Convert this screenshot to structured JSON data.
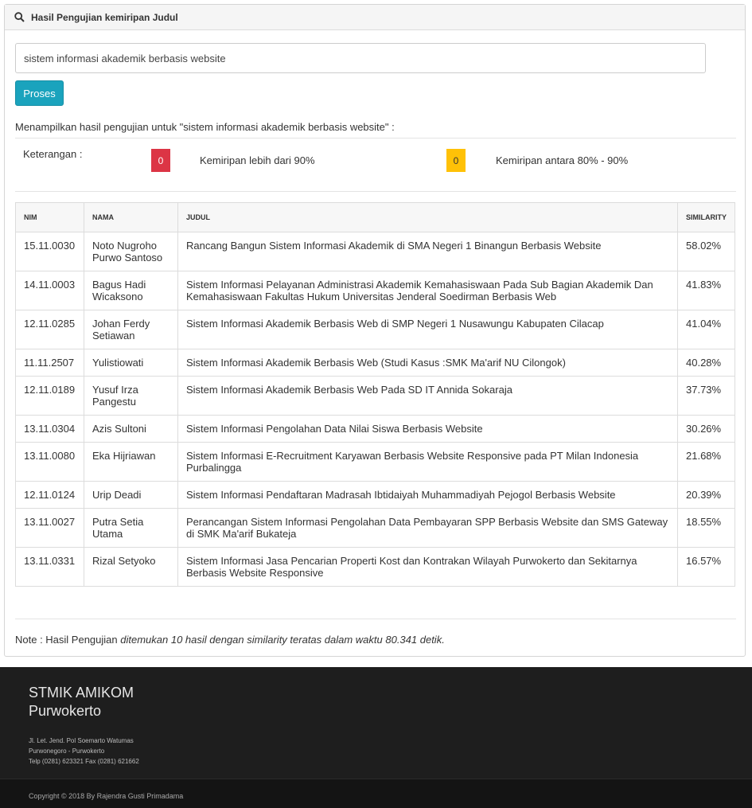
{
  "panel": {
    "title": "Hasil Pengujian kemiripan Judul"
  },
  "search": {
    "value": "sistem informasi akademik berbasis website"
  },
  "button": {
    "label": "Proses"
  },
  "result_message": "Menampilkan hasil pengujian untuk \"sistem informasi akademik berbasis website\" :",
  "legend": {
    "label": "Keterangan :",
    "red_count": "0",
    "red_text": "Kemiripan lebih dari 90%",
    "yellow_count": "0",
    "yellow_text": "Kemiripan antara 80% - 90%",
    "colors": {
      "red": "#dc3545",
      "yellow": "#ffc107"
    }
  },
  "table": {
    "headers": [
      "NIM",
      "NAMA",
      "JUDUL",
      "SIMILARITY"
    ],
    "rows": [
      [
        "15.11.0030",
        "Noto Nugroho Purwo Santoso",
        "Rancang Bangun Sistem Informasi Akademik di SMA Negeri 1 Binangun Berbasis Website",
        "58.02%"
      ],
      [
        "14.11.0003",
        "Bagus Hadi Wicaksono",
        "Sistem Informasi Pelayanan Administrasi Akademik Kemahasiswaan Pada Sub Bagian Akademik Dan Kemahasiswaan Fakultas Hukum Universitas Jenderal Soedirman Berbasis Web",
        "41.83%"
      ],
      [
        "12.11.0285",
        "Johan Ferdy Setiawan",
        "Sistem Informasi Akademik Berbasis Web di SMP Negeri 1 Nusawungu Kabupaten Cilacap",
        "41.04%"
      ],
      [
        "11.11.2507",
        "Yulistiowati",
        "Sistem Informasi Akademik Berbasis Web (Studi Kasus :SMK Ma'arif NU Cilongok)",
        "40.28%"
      ],
      [
        "12.11.0189",
        "Yusuf Irza Pangestu",
        "Sistem Informasi Akademik Berbasis Web Pada SD IT Annida Sokaraja",
        "37.73%"
      ],
      [
        "13.11.0304",
        "Azis Sultoni",
        "Sistem Informasi Pengolahan Data Nilai Siswa Berbasis Website",
        "30.26%"
      ],
      [
        "13.11.0080",
        "Eka Hijriawan",
        "Sistem Informasi E-Recruitment Karyawan Berbasis Website Responsive pada PT Milan Indonesia Purbalingga",
        "21.68%"
      ],
      [
        "12.11.0124",
        "Urip Deadi",
        "Sistem Informasi Pendaftaran Madrasah Ibtidaiyah Muhammadiyah Pejogol Berbasis Website",
        "20.39%"
      ],
      [
        "13.11.0027",
        "Putra Setia Utama",
        "Perancangan Sistem Informasi Pengolahan Data Pembayaran SPP Berbasis Website dan SMS Gateway di SMK Ma'arif Bukateja",
        "18.55%"
      ],
      [
        "13.11.0331",
        "Rizal Setyoko",
        "Sistem Informasi Jasa Pencarian Properti Kost dan Kontrakan Wilayah Purwokerto dan Sekitarnya Berbasis Website Responsive",
        "16.57%"
      ]
    ]
  },
  "note": {
    "prefix": "Note : Hasil Pengujian ",
    "italic": "ditemukan 10 hasil dengan similarity teratas dalam waktu 80.341 detik."
  },
  "footer": {
    "org_line1": "STMIK AMIKOM",
    "org_line2": "Purwokerto",
    "address": [
      "Jl. Let. Jend. Pol Soemarto Watumas",
      "Purwonegoro - Purwokerto",
      "Telp (0281) 623321 Fax (0281) 621662"
    ],
    "copyright": "Copyright © 2018 By Rajendra Gusti Primadama"
  }
}
